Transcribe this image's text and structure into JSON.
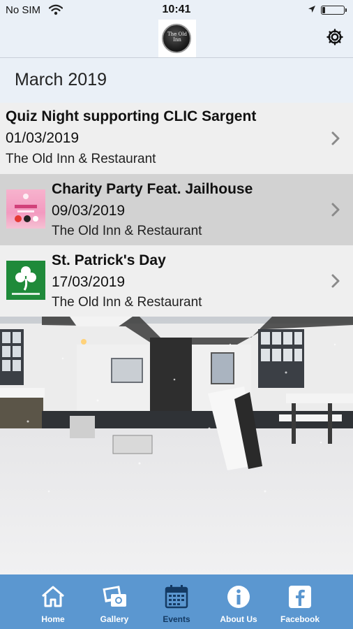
{
  "status_bar": {
    "carrier": "No SIM",
    "time": "10:41",
    "battery_level": 0.15
  },
  "header": {
    "logo_text": "The Old Inn",
    "settings_icon": "gear-icon"
  },
  "month": "March 2019",
  "events": [
    {
      "title": "Quiz Night supporting CLIC Sargent",
      "date": "01/03/2019",
      "venue": "The Old Inn & Restaurant",
      "has_thumbnail": false
    },
    {
      "title": "Charity Party Feat. Jailhouse",
      "date": "09/03/2019",
      "venue": "The Old Inn & Restaurant",
      "has_thumbnail": true,
      "thumbnail_icon": "party-poster-thumbnail"
    },
    {
      "title": "St. Patrick's Day",
      "date": "17/03/2019",
      "venue": "The Old Inn & Restaurant",
      "has_thumbnail": true,
      "thumbnail_icon": "shamrock-thumbnail"
    }
  ],
  "tabs": [
    {
      "label": "Home",
      "icon": "home-icon",
      "active": false
    },
    {
      "label": "Gallery",
      "icon": "gallery-icon",
      "active": false
    },
    {
      "label": "Events",
      "icon": "calendar-icon",
      "active": true
    },
    {
      "label": "About Us",
      "icon": "info-icon",
      "active": false
    },
    {
      "label": "Facebook",
      "icon": "facebook-icon",
      "active": false
    }
  ],
  "colors": {
    "header_bg": "#eaf0f7",
    "row_bg": "#efefef",
    "row_selected_bg": "#d2d2d2",
    "tabbar_bg": "#5b97d0",
    "tab_active_label": "#143a63"
  }
}
